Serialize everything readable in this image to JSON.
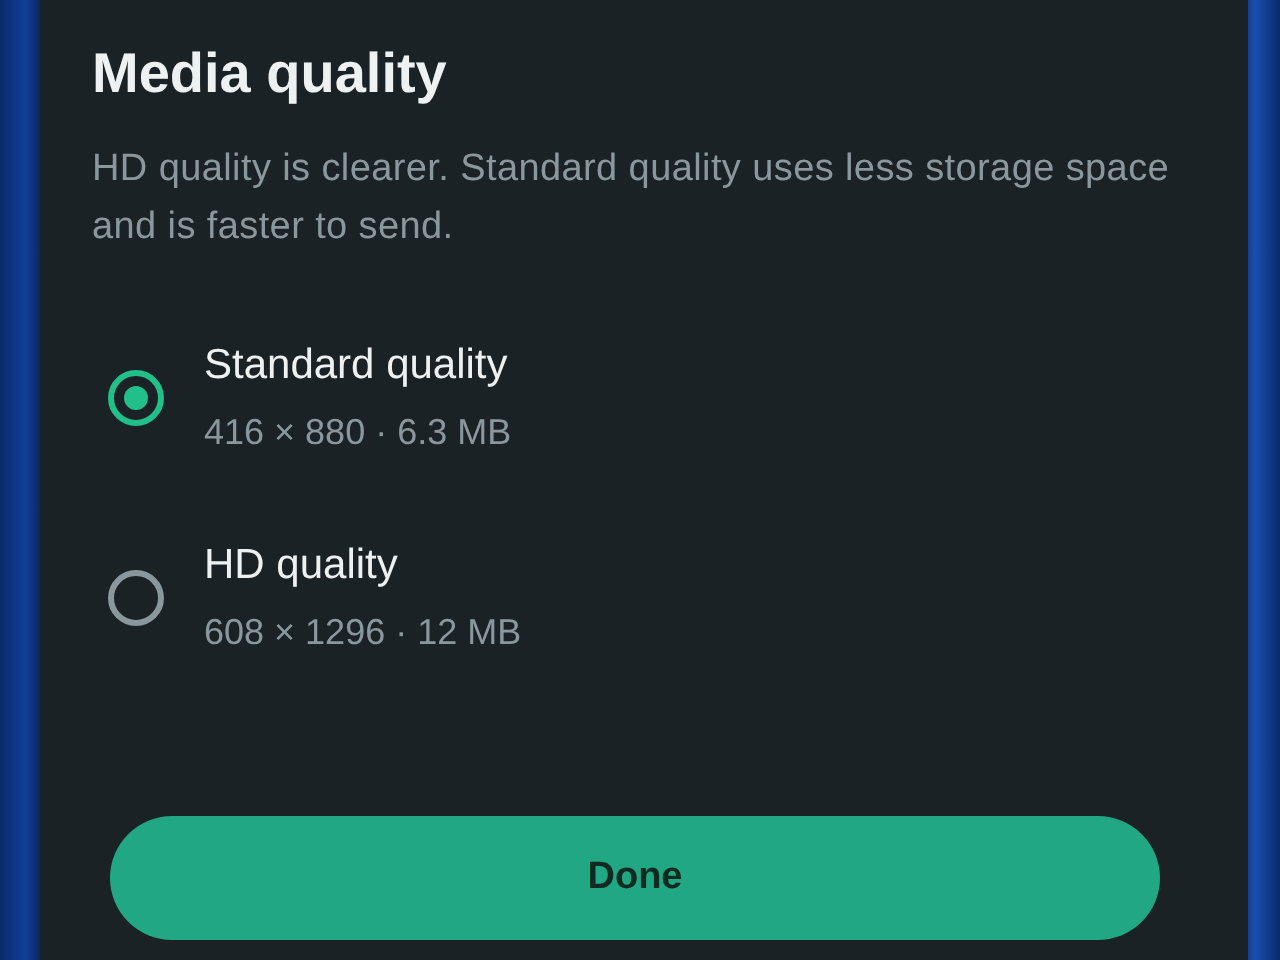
{
  "dialog": {
    "title": "Media quality",
    "description": "HD quality is clearer. Standard quality uses less storage space and is faster to send.",
    "options": [
      {
        "label": "Standard quality",
        "detail": "416 × 880 · 6.3 MB",
        "selected": true
      },
      {
        "label": "HD quality",
        "detail": "608 × 1296 · 12 MB",
        "selected": false
      }
    ],
    "button": "Done"
  }
}
